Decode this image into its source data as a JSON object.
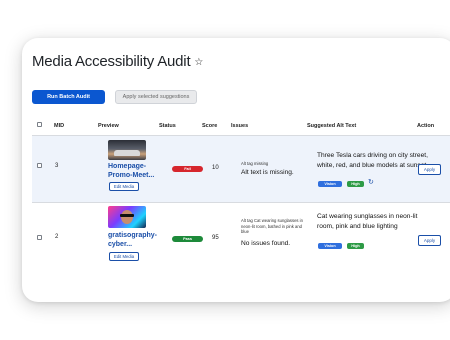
{
  "page": {
    "title": "Media Accessibility Audit",
    "star_icon": "☆"
  },
  "toolbar": {
    "run_batch_label": "Run Batch Audit",
    "apply_suggestions_label": "Apply selected suggestions"
  },
  "table": {
    "columns": [
      "MID",
      "Preview",
      "Status",
      "Score",
      "Issues",
      "Suggested Alt Text",
      "Action"
    ],
    "rows": [
      {
        "mid": "3",
        "title": "Homepage-Promo-Meet...",
        "edit_label": "Edit Media",
        "status": "Fail",
        "status_color": "#d6262d",
        "score": "10",
        "issues_detail": "Alt tag missing",
        "issues_summary": "Alt text is missing.",
        "suggestion": "Three Tesla cars driving on city street, white, red, and blue models at sunset",
        "tags": [
          "Vision",
          "High"
        ],
        "action_label": "Apply"
      },
      {
        "mid": "2",
        "title": "gratisography-cyber...",
        "edit_label": "Edit Media",
        "status": "Pass",
        "status_color": "#1d8a3a",
        "score": "95",
        "issues_detail": "Alt tag Cat wearing sunglasses in neon-lit room, bathed in pink and blue",
        "issues_summary": "No issues found.",
        "suggestion": "Cat wearing sunglasses in neon-lit room, pink and blue lighting",
        "tags": [
          "Vision",
          "High"
        ],
        "action_label": "Apply"
      }
    ]
  },
  "colors": {
    "primary": "#0b57d0",
    "fail": "#d6262d",
    "pass": "#1d8a3a",
    "vision_tag": "#2f6fde",
    "high_tag": "#2e9b46",
    "row_highlight": "#eef3fb"
  },
  "icons": {
    "refresh": "↻"
  }
}
